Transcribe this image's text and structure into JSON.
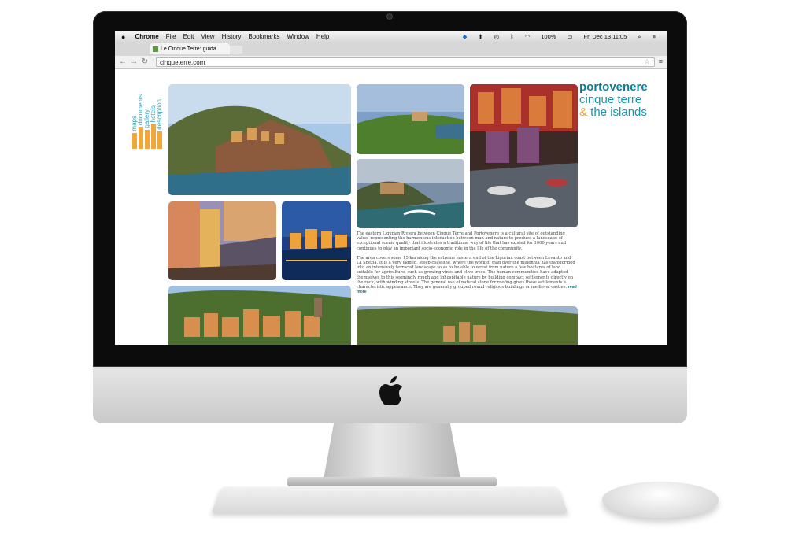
{
  "menubar": {
    "apple": "",
    "items": [
      "Chrome",
      "File",
      "Edit",
      "View",
      "History",
      "Bookmarks",
      "Window",
      "Help"
    ],
    "battery": "100%",
    "datetime": "Fri Dec 13  11:05"
  },
  "browser": {
    "tab_title": "Le Cinque Terre: guida",
    "url": "cinqueterre.com",
    "back_icon": "back-arrow-icon",
    "forward_icon": "forward-arrow-icon",
    "reload_icon": "reload-icon",
    "star_icon": "bookmark-star-icon",
    "menu_icon": "hamburger-menu-icon"
  },
  "site": {
    "nav": [
      "maps",
      "documents",
      "gallery",
      "hotels",
      "description"
    ],
    "brand_line1": "portovenere",
    "brand_line2": "cinque terre",
    "brand_amp": "&",
    "brand_line3": " the islands",
    "paragraph1": "The eastern Ligurian Riviera between Cinque Terre and Portovenere is a cultural site of outstanding value, representing the harmonious interaction between man and nature to produce a landscape of exceptional scenic quality that illustrates a traditional way of life that has existed for 1000 years and continues to play an important socio-economic role in the life of the community.",
    "paragraph2": "The area covers some 15 km along the extreme eastern end of the Ligurian coast between Levanto and La Spezia. It is a very jagged, steep coastline, where the work of man over the millennia has transformed into an intensively terraced landscape so as to be able to wrest from nature a few hectares of land suitable for agriculture, such as growing vines and olive trees. The human communities have adapted themselves to this seemingly rough and inhospitable nature by building compact settlements directly on the rock, with winding streets. The general use of natural stone for roofing gives these settlements a characteristic appearance. They are generally grouped round religious buildings or medieval castles.",
    "read_more": "read more"
  },
  "colors": {
    "accent_teal": "#0d7f92",
    "accent_orange": "#f2a33a"
  }
}
